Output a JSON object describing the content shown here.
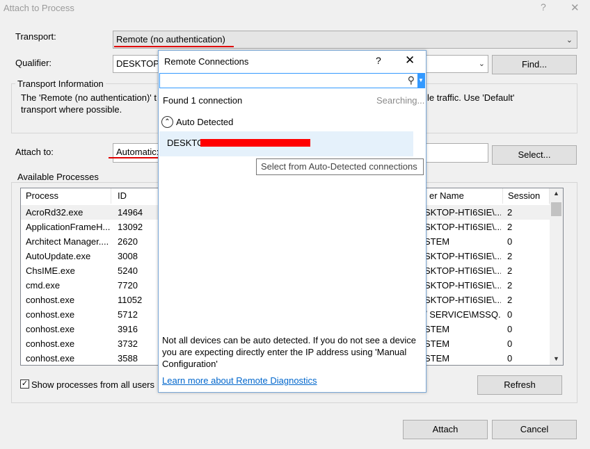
{
  "window": {
    "title": "Attach to Process",
    "help_glyph": "?",
    "close_glyph": "✕"
  },
  "transport": {
    "label": "Transport:",
    "value": "Remote (no authentication)"
  },
  "qualifier": {
    "label": "Qualifier:",
    "value": "DESKTOP-",
    "find_label": "Find..."
  },
  "transport_info": {
    "title": "Transport Information",
    "line1_left": "The 'Remote (no authentication)' t",
    "line1_right": "le traffic. Use 'Default'",
    "line2": "transport where possible."
  },
  "attach_to": {
    "label": "Attach to:",
    "value": "Automatic:",
    "select_label": "Select..."
  },
  "processes": {
    "title": "Available Processes",
    "columns": [
      "Process",
      "ID",
      "er Name",
      "Session"
    ],
    "rows": [
      {
        "process": "AcroRd32.exe",
        "id": "14964",
        "user": "SKTOP-HTI6SIE\\...",
        "session": "2"
      },
      {
        "process": "ApplicationFrameH...",
        "id": "13092",
        "user": "SKTOP-HTI6SIE\\...",
        "session": "2"
      },
      {
        "process": "Architect Manager....",
        "id": "2620",
        "user": "STEM",
        "session": "0"
      },
      {
        "process": "AutoUpdate.exe",
        "id": "3008",
        "user": "SKTOP-HTI6SIE\\...",
        "session": "2"
      },
      {
        "process": "ChsIME.exe",
        "id": "5240",
        "user": "SKTOP-HTI6SIE\\...",
        "session": "2"
      },
      {
        "process": "cmd.exe",
        "id": "7720",
        "user": "SKTOP-HTI6SIE\\...",
        "session": "2"
      },
      {
        "process": "conhost.exe",
        "id": "11052",
        "user": "SKTOP-HTI6SIE\\...",
        "session": "2"
      },
      {
        "process": "conhost.exe",
        "id": "5712",
        "user": "/ SERVICE\\MSSQ...",
        "session": "0"
      },
      {
        "process": "conhost.exe",
        "id": "3916",
        "user": "STEM",
        "session": "0"
      },
      {
        "process": "conhost.exe",
        "id": "3732",
        "user": "STEM",
        "session": "0"
      },
      {
        "process": "conhost.exe",
        "id": "3588",
        "user": "STEM",
        "session": "0"
      }
    ]
  },
  "show_all": {
    "label": "Show processes from all users",
    "checked": true
  },
  "buttons": {
    "refresh": "Refresh",
    "attach": "Attach",
    "cancel": "Cancel"
  },
  "popup": {
    "title": "Remote Connections",
    "help_glyph": "?",
    "close_glyph": "✕",
    "search_value": "",
    "found": "Found 1 connection",
    "searching": "Searching...",
    "group_label": "Auto Detected",
    "connection_name": "DESKTO",
    "tooltip": "Select from Auto-Detected connections",
    "note": "Not all devices can be auto detected. If you do not see a device you are expecting directly enter the IP address using 'Manual Configuration'",
    "link": "Learn more about Remote Diagnostics"
  },
  "colors": {
    "accent": "#3399ff",
    "redline": "#e00000",
    "link": "#0066cc"
  }
}
